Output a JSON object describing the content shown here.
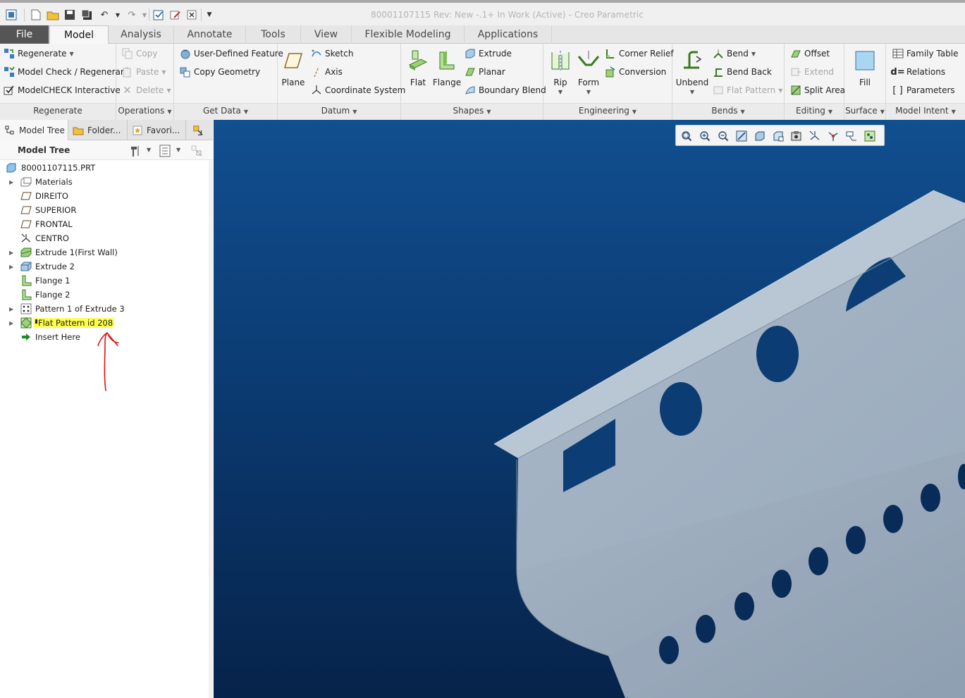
{
  "window": {
    "title": "80001107115 Rev: New -.1+ In Work  (Active) - Creo Parametric"
  },
  "tabs": [
    {
      "label": "File"
    },
    {
      "label": "Model"
    },
    {
      "label": "Analysis"
    },
    {
      "label": "Annotate"
    },
    {
      "label": "Tools"
    },
    {
      "label": "View"
    },
    {
      "label": "Flexible Modeling"
    },
    {
      "label": "Applications"
    }
  ],
  "ribbon": {
    "regenerate": {
      "label": "Regenerate",
      "items": [
        "Regenerate",
        "Model Check / Regenerar",
        "ModelCHECK Interactive"
      ]
    },
    "operations": {
      "label": "Operations",
      "items": [
        "Copy",
        "Paste",
        "Delete"
      ]
    },
    "getdata": {
      "label": "Get Data",
      "items": [
        "User-Defined Feature",
        "Copy Geometry"
      ]
    },
    "datum": {
      "label": "Datum",
      "big": "Plane",
      "items": [
        "Sketch",
        "Axis",
        "Coordinate System"
      ]
    },
    "shapes": {
      "label": "Shapes",
      "big": [
        "Flat",
        "Flange"
      ],
      "items": [
        "Extrude",
        "Planar",
        "Boundary Blend"
      ]
    },
    "engineering": {
      "label": "Engineering",
      "big": [
        "Rip",
        "Form"
      ],
      "items": [
        "Corner Relief",
        "Conversion"
      ]
    },
    "bends": {
      "label": "Bends",
      "big": "Unbend",
      "items": [
        "Bend",
        "Bend Back",
        "Flat Pattern"
      ]
    },
    "editing": {
      "label": "Editing",
      "items": [
        "Offset",
        "Extend",
        "Split Area"
      ]
    },
    "surface": {
      "label": "Surface",
      "big": "Fill"
    },
    "modelintent": {
      "label": "Model Intent",
      "items": [
        "Family Table",
        "Relations",
        "Parameters"
      ]
    }
  },
  "panel": {
    "tabs": [
      "Model Tree",
      "Folder...",
      "Favori..."
    ],
    "header": "Model Tree"
  },
  "tree": [
    {
      "label": "80001107115.PRT"
    },
    {
      "label": "Materials"
    },
    {
      "label": "DIREITO"
    },
    {
      "label": "SUPERIOR"
    },
    {
      "label": "FRONTAL"
    },
    {
      "label": "CENTRO"
    },
    {
      "label": "Extrude 1(First Wall)"
    },
    {
      "label": "Extrude 2"
    },
    {
      "label": "Flange 1"
    },
    {
      "label": "Flange 2"
    },
    {
      "label": "Pattern 1 of Extrude 3"
    },
    {
      "label": "Flat Pattern id 208"
    },
    {
      "label": "Insert Here"
    }
  ],
  "colors": {
    "highlight": "#ffff4d",
    "annotation": "#e01010",
    "viewport_top": "#114f8f",
    "viewport_bottom": "#06234a",
    "part": "#a3b3c4"
  }
}
